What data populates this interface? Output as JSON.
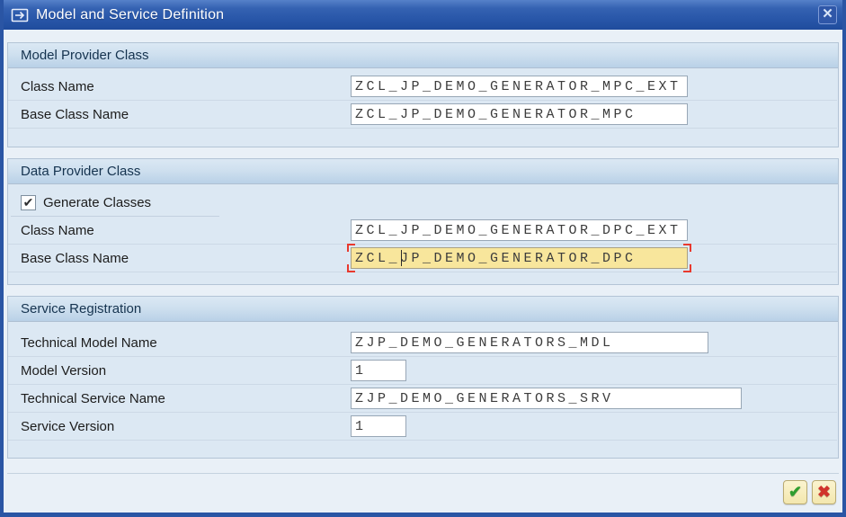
{
  "title_bar": {
    "title": "Model and Service Definition"
  },
  "icons": {
    "close": "✕",
    "checkbox_check": "✔",
    "ok": "✔",
    "cancel": "✖"
  },
  "colors": {
    "title_blue": "#2b59ab",
    "section_header_blue": "#bfd5e9",
    "focus_field_yellow": "#f8e69c",
    "focus_bracket_red": "#e8392e",
    "ok_green": "#2f9e2f",
    "cancel_red": "#d0342c"
  },
  "model_provider": {
    "title": "Model Provider Class",
    "class_name": {
      "label": "Class Name",
      "value": "ZCL_JP_DEMO_GENERATOR_MPC_EXT"
    },
    "base_class_name": {
      "label": "Base Class Name",
      "value": "ZCL_JP_DEMO_GENERATOR_MPC"
    }
  },
  "data_provider": {
    "title": "Data Provider Class",
    "generate_classes": {
      "label": "Generate Classes",
      "checked": true
    },
    "class_name": {
      "label": "Class Name",
      "value": "ZCL_JP_DEMO_GENERATOR_DPC_EXT"
    },
    "base_class_name": {
      "label": "Base Class Name",
      "value": "ZCL_JP_DEMO_GENERATOR_DPC",
      "focused": true
    }
  },
  "service_registration": {
    "title": "Service Registration",
    "technical_model_name": {
      "label": "Technical Model Name",
      "value": "ZJP_DEMO_GENERATORS_MDL"
    },
    "model_version": {
      "label": "Model Version",
      "value": "1"
    },
    "technical_service_name": {
      "label": "Technical Service Name",
      "value": "ZJP_DEMO_GENERATORS_SRV"
    },
    "service_version": {
      "label": "Service Version",
      "value": "1"
    }
  }
}
